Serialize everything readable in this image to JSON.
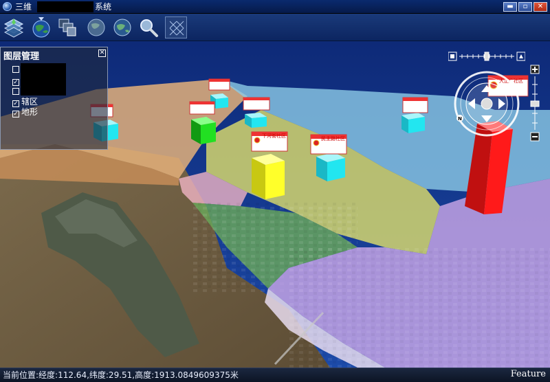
{
  "window": {
    "title_prefix": "三维",
    "title_suffix": "系统",
    "controls": {
      "minimize": "▬",
      "maximize": "▫",
      "close": "✕"
    }
  },
  "toolbar": {
    "tools": [
      {
        "name": "layers-icon"
      },
      {
        "name": "globe-dropdown-icon"
      },
      {
        "name": "windows-icon"
      },
      {
        "name": "globe-icon"
      },
      {
        "name": "globe-rotate-icon"
      },
      {
        "name": "magnifier-icon"
      },
      {
        "name": "grid-select-icon"
      }
    ]
  },
  "layer_panel": {
    "title": "图层管理",
    "close_label": "☒",
    "layers": [
      {
        "label": "",
        "checked": false
      },
      {
        "label": "",
        "checked": true
      },
      {
        "label": "",
        "checked": false
      },
      {
        "label": "辖区",
        "checked": true
      },
      {
        "label": "地形",
        "checked": true
      }
    ]
  },
  "scene": {
    "community_labels": {
      "xia_he_jie": "下河街社区",
      "min_zhu_lu": "民主路社区",
      "big_plaza": "大正广社区"
    },
    "colors": {
      "river": "#6b5a3e",
      "zone_purple": "#c9a6e6",
      "zone_yellow": "#e6e46a",
      "zone_green": "#6aa85a",
      "zone_blue": "#8ccbe6",
      "zone_orange": "#e4b07a",
      "bar_red": "#ff1a1a",
      "bar_yellow": "#ffff2a",
      "bar_green": "#22e022",
      "bar_cyan": "#22e6f0"
    }
  },
  "status": {
    "text": "当前位置:经度:112.64,纬度:29.51,高度:1913.0849609375米",
    "brand": "Feature"
  }
}
